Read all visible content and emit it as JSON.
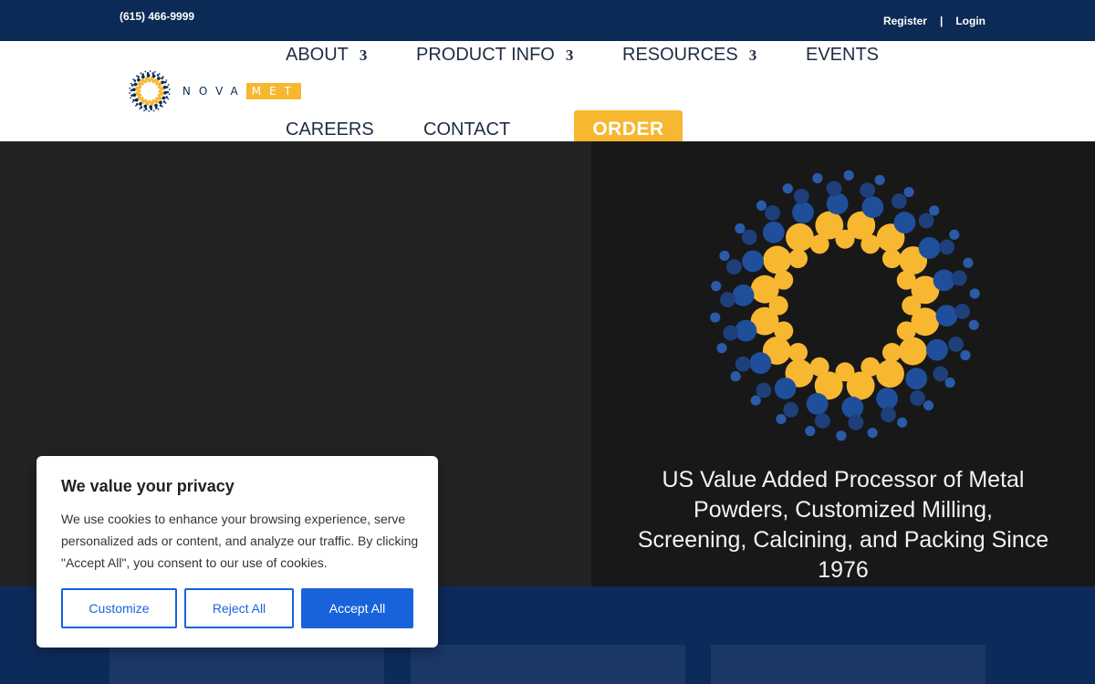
{
  "topbar": {
    "phone": "(615) 466-9999",
    "register": "Register",
    "separator": "|",
    "login": "Login"
  },
  "logo": {
    "wordmark_a": "NOVA",
    "wordmark_b": "MET"
  },
  "nav": {
    "about": "ABOUT",
    "product_info": "PRODUCT INFO",
    "resources": "RESOURCES",
    "events": "EVENTS",
    "careers": "CAREERS",
    "contact": "CONTACT",
    "order": "ORDER",
    "caret": "3"
  },
  "hero": {
    "tagline": "US Value Added Processor of Metal Powders, Customized Milling, Screening, Calcining, and Packing Since 1976"
  },
  "cookie": {
    "title": "We value your privacy",
    "body": "We use cookies to enhance your browsing experience, serve personalized ads or content, and analyze our traffic. By clicking \"Accept All\", you consent to our use of cookies.",
    "customize": "Customize",
    "reject": "Reject All",
    "accept": "Accept All"
  },
  "colors": {
    "navy": "#0b2a55",
    "gold": "#f7b731",
    "accept_blue": "#1863dc"
  }
}
